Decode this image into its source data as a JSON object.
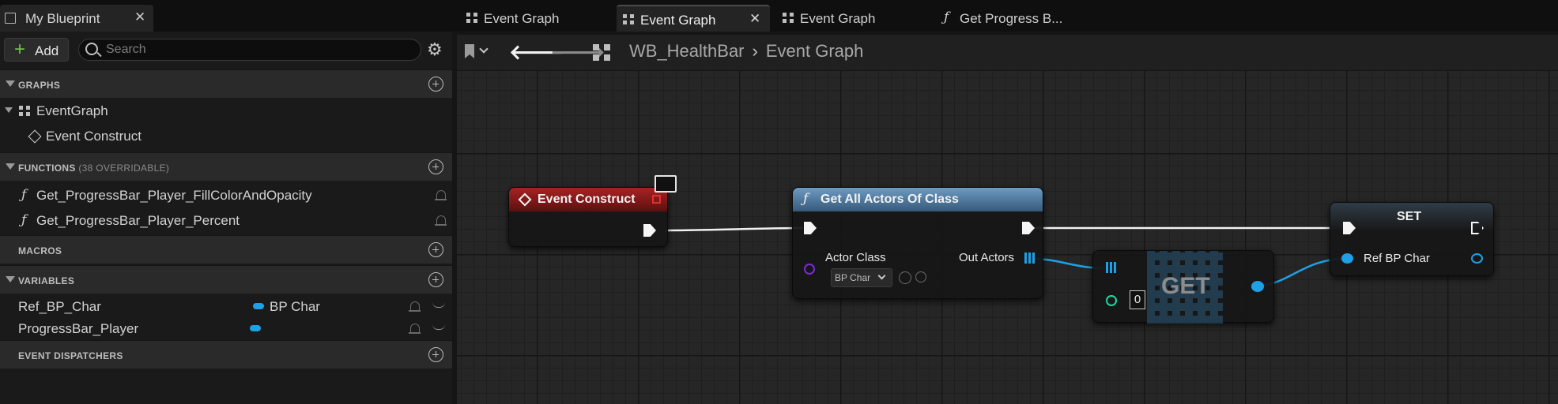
{
  "left_panel": {
    "tab_title": "My Blueprint",
    "add_label": "Add",
    "search_placeholder": "Search",
    "sections": {
      "graphs": "GRAPHS",
      "functions": "FUNCTIONS",
      "functions_sub": "(38 OVERRIDABLE)",
      "macros": "MACROS",
      "variables": "VARIABLES",
      "event_dispatchers": "EVENT DISPATCHERS"
    },
    "graphs": {
      "event_graph": "EventGraph",
      "event_construct": "Event Construct"
    },
    "functions": [
      "Get_ProgressBar_Player_FillColorAndOpacity",
      "Get_ProgressBar_Player_Percent"
    ],
    "variables": [
      {
        "name": "Ref_BP_Char",
        "type": "BP Char"
      },
      {
        "name": "ProgressBar_Player",
        "type": ""
      }
    ]
  },
  "doc_tabs": [
    "Event Graph",
    "Event Graph",
    "Event Graph",
    "Get Progress B..."
  ],
  "graph": {
    "breadcrumb_root": "WB_HealthBar",
    "breadcrumb_current": "Event Graph",
    "nodes": {
      "event_construct": "Event Construct",
      "get_all_actors": "Get All Actors Of Class",
      "actor_class_label": "Actor Class",
      "actor_class_value": "BP Char",
      "out_actors_label": "Out Actors",
      "get": "GET",
      "get_index": "0",
      "set": "SET",
      "ref_bp_char": "Ref BP Char"
    }
  },
  "colors": {
    "event_header": "#8b1a1a",
    "function_header": "#4d7da3",
    "object_pin": "#1ea0e6",
    "exec_pin": "#f5f5f5",
    "class_pin": "#7a2bd6",
    "int_pin": "#1ed6a0"
  }
}
